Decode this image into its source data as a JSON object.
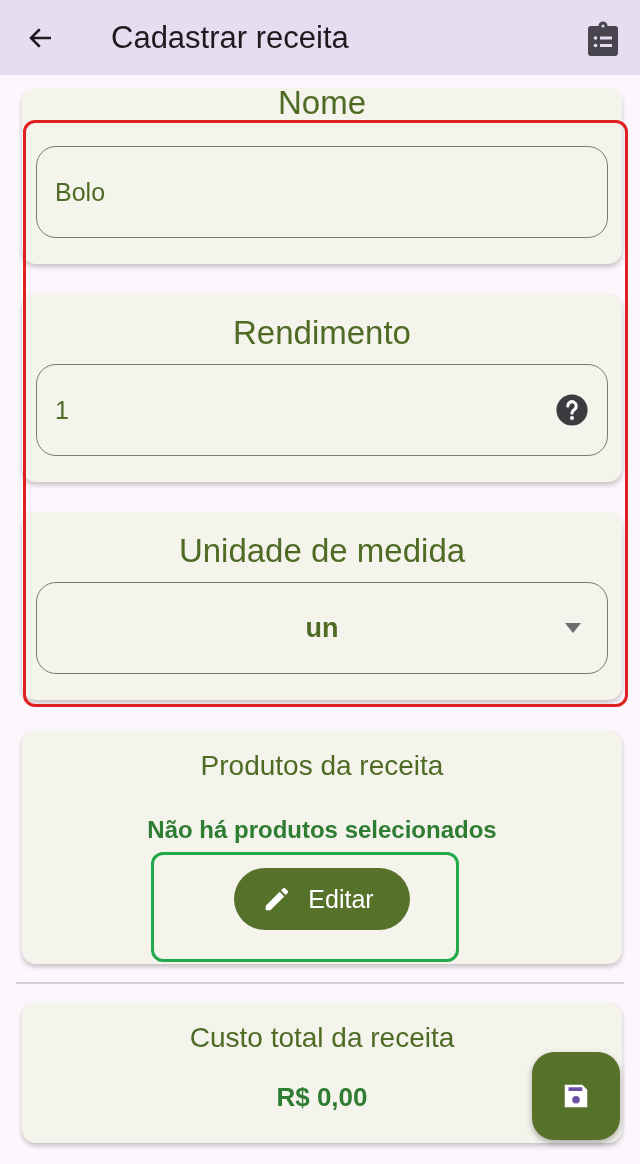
{
  "app_bar": {
    "title": "Cadastrar receita"
  },
  "fields": [
    {
      "kind": "text",
      "label": "Nome",
      "value": "Bolo"
    },
    {
      "kind": "help",
      "label": "Rendimento",
      "value": "1"
    },
    {
      "kind": "dropdown",
      "label": "Unidade de medida",
      "value": "un"
    }
  ],
  "products": {
    "title": "Produtos da receita",
    "empty_message": "Não há produtos selecionados",
    "button": "Editar"
  },
  "total": {
    "title": "Custo total da receita",
    "value": "R$ 0,00"
  },
  "annotations": [
    {
      "color": "#e02020"
    },
    {
      "color": "#22aa4a"
    }
  ]
}
